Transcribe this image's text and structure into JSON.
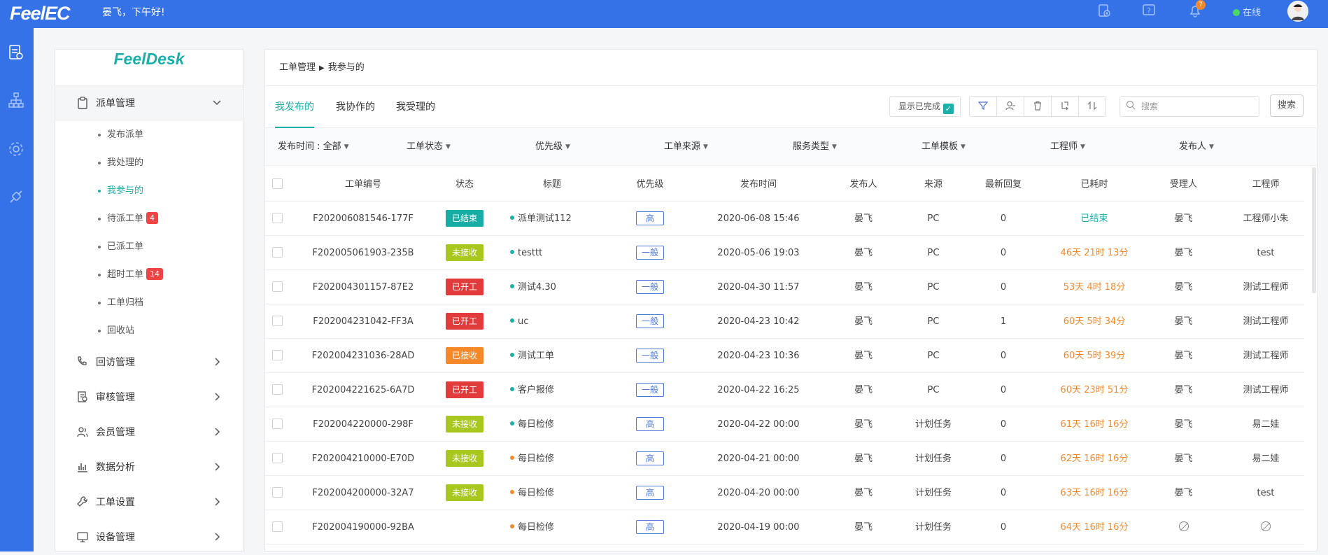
{
  "app": {
    "logo": "FeelEC",
    "greeting": "晏飞，下午好!",
    "notification_count": "7",
    "online_label": "在线",
    "accent": "#3572e8",
    "teal": "#1ab0a8"
  },
  "topbar_icons": [
    "new-doc-icon",
    "help-icon",
    "bell-icon"
  ],
  "rail_icons": [
    "ticket-icon",
    "org-icon",
    "gear-icon",
    "plug-icon"
  ],
  "sidebar": {
    "logo": "FeelDesk",
    "section_dispatch": "派单管理",
    "sub_items": [
      {
        "label": "发布派单",
        "count": ""
      },
      {
        "label": "我处理的",
        "count": ""
      },
      {
        "label": "我参与的",
        "count": ""
      },
      {
        "label": "待派工单",
        "count": "4"
      },
      {
        "label": "已派工单",
        "count": ""
      },
      {
        "label": "超时工单",
        "count": "14"
      },
      {
        "label": "工单归档",
        "count": ""
      },
      {
        "label": "回收站",
        "count": ""
      }
    ],
    "sections": [
      {
        "label": "回访管理",
        "icon": "phone-icon"
      },
      {
        "label": "审核管理",
        "icon": "audit-icon"
      },
      {
        "label": "会员管理",
        "icon": "members-icon"
      },
      {
        "label": "数据分析",
        "icon": "chart-icon"
      },
      {
        "label": "工单设置",
        "icon": "wrench-icon"
      },
      {
        "label": "设备管理",
        "icon": "device-icon"
      }
    ]
  },
  "breadcrumb": {
    "root": "工单管理",
    "current": "我参与的"
  },
  "tabs": [
    "我发布的",
    "我协作的",
    "我受理的"
  ],
  "toolbar": {
    "show_completed": "显示已完成",
    "search_placeholder": "搜索",
    "search_button": "搜索"
  },
  "filters": [
    "发布时间 : 全部",
    "工单状态",
    "优先级",
    "工单来源",
    "服务类型",
    "工单模板",
    "工程师",
    "发布人"
  ],
  "columns": [
    "工单编号",
    "状态",
    "标题",
    "优先级",
    "发布时间",
    "发布人",
    "来源",
    "最新回复",
    "已耗时",
    "受理人",
    "工程师"
  ],
  "status_colors": {
    "已结束": "#17ada5",
    "未接收": "#a8c81f",
    "已开工": "#e23b3b",
    "已接收": "#f5892a"
  },
  "rows": [
    {
      "id": "F202006081546-177F",
      "status": "已结束",
      "title": "派单测试112",
      "dot": "#1ab0a8",
      "priority": "高",
      "time": "2020-06-08 15:46",
      "publisher": "晏飞",
      "source": "PC",
      "reply": "0",
      "elapsed": "已结束",
      "done": true,
      "assignee": "晏飞",
      "engineer": "工程师小朱"
    },
    {
      "id": "F202005061903-235B",
      "status": "未接收",
      "title": "testtt",
      "dot": "#1ab0a8",
      "priority": "一般",
      "time": "2020-05-06 19:03",
      "publisher": "晏飞",
      "source": "PC",
      "reply": "0",
      "elapsed": "46天 21时 13分",
      "done": false,
      "assignee": "晏飞",
      "engineer": "test"
    },
    {
      "id": "F202004301157-87E2",
      "status": "已开工",
      "title": "测试4.30",
      "dot": "#1ab0a8",
      "priority": "一般",
      "time": "2020-04-30 11:57",
      "publisher": "晏飞",
      "source": "PC",
      "reply": "0",
      "elapsed": "53天 4时 18分",
      "done": false,
      "assignee": "晏飞",
      "engineer": "测试工程师"
    },
    {
      "id": "F202004231042-FF3A",
      "status": "已开工",
      "title": "uc",
      "dot": "#1ab0a8",
      "priority": "一般",
      "time": "2020-04-23 10:42",
      "publisher": "晏飞",
      "source": "PC",
      "reply": "1",
      "elapsed": "60天 5时 34分",
      "done": false,
      "assignee": "晏飞",
      "engineer": "测试工程师"
    },
    {
      "id": "F202004231036-28AD",
      "status": "已接收",
      "title": "测试工单",
      "dot": "#1ab0a8",
      "priority": "一般",
      "time": "2020-04-23 10:36",
      "publisher": "晏飞",
      "source": "PC",
      "reply": "0",
      "elapsed": "60天 5时 39分",
      "done": false,
      "assignee": "晏飞",
      "engineer": "测试工程师"
    },
    {
      "id": "F202004221625-6A7D",
      "status": "已开工",
      "title": "客户报修",
      "dot": "#1ab0a8",
      "priority": "一般",
      "time": "2020-04-22 16:25",
      "publisher": "晏飞",
      "source": "PC",
      "reply": "0",
      "elapsed": "60天 23时 51分",
      "done": false,
      "assignee": "晏飞",
      "engineer": "测试工程师"
    },
    {
      "id": "F202004220000-298F",
      "status": "未接收",
      "title": "每日检修",
      "dot": "#1ab0a8",
      "priority": "高",
      "time": "2020-04-22 00:00",
      "publisher": "晏飞",
      "source": "计划任务",
      "reply": "0",
      "elapsed": "61天 16时 16分",
      "done": false,
      "assignee": "晏飞",
      "engineer": "易二娃"
    },
    {
      "id": "F202004210000-E70D",
      "status": "未接收",
      "title": "每日检修",
      "dot": "#f5892a",
      "priority": "高",
      "time": "2020-04-21 00:00",
      "publisher": "晏飞",
      "source": "计划任务",
      "reply": "0",
      "elapsed": "62天 16时 16分",
      "done": false,
      "assignee": "晏飞",
      "engineer": "易二娃"
    },
    {
      "id": "F202004200000-32A7",
      "status": "未接收",
      "title": "每日检修",
      "dot": "#f5892a",
      "priority": "高",
      "time": "2020-04-20 00:00",
      "publisher": "晏飞",
      "source": "计划任务",
      "reply": "0",
      "elapsed": "63天 16时 16分",
      "done": false,
      "assignee": "晏飞",
      "engineer": "test"
    },
    {
      "id": "F202004190000-92BA",
      "status": "",
      "title": "每日检修",
      "dot": "#f5892a",
      "priority": "高",
      "time": "2020-04-19 00:00",
      "publisher": "晏飞",
      "source": "计划任务",
      "reply": "0",
      "elapsed": "64天 16时 16分",
      "done": false,
      "assignee": "",
      "engineer": ""
    }
  ]
}
